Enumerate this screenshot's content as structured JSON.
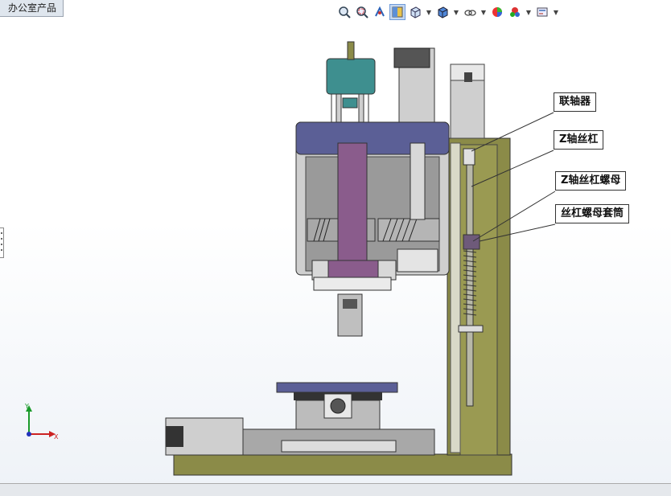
{
  "tab": {
    "label": "办公室产品"
  },
  "toolbar": {
    "icons": [
      "zoom-to-fit-icon",
      "zoom-to-area-icon",
      "previous-view-icon",
      "section-view-icon",
      "view-orientation-icon",
      "display-style-icon",
      "hide-show-items-icon",
      "edit-appearance-icon",
      "apply-scene-icon",
      "view-settings-icon"
    ]
  },
  "callouts": {
    "coupling": "联轴器",
    "z_screw": "Z轴丝杠",
    "z_screw_nut": "Z轴丝杠螺母",
    "nut_sleeve": "丝杠螺母套筒"
  },
  "triad": {
    "y": "Y",
    "x": "X"
  },
  "colors": {
    "frame": "#8b8b48",
    "housing": "#cfcfcf",
    "cap": "#5b5f96",
    "spindle": "#8a5c8c",
    "motor_teal": "#3e8f8f"
  }
}
